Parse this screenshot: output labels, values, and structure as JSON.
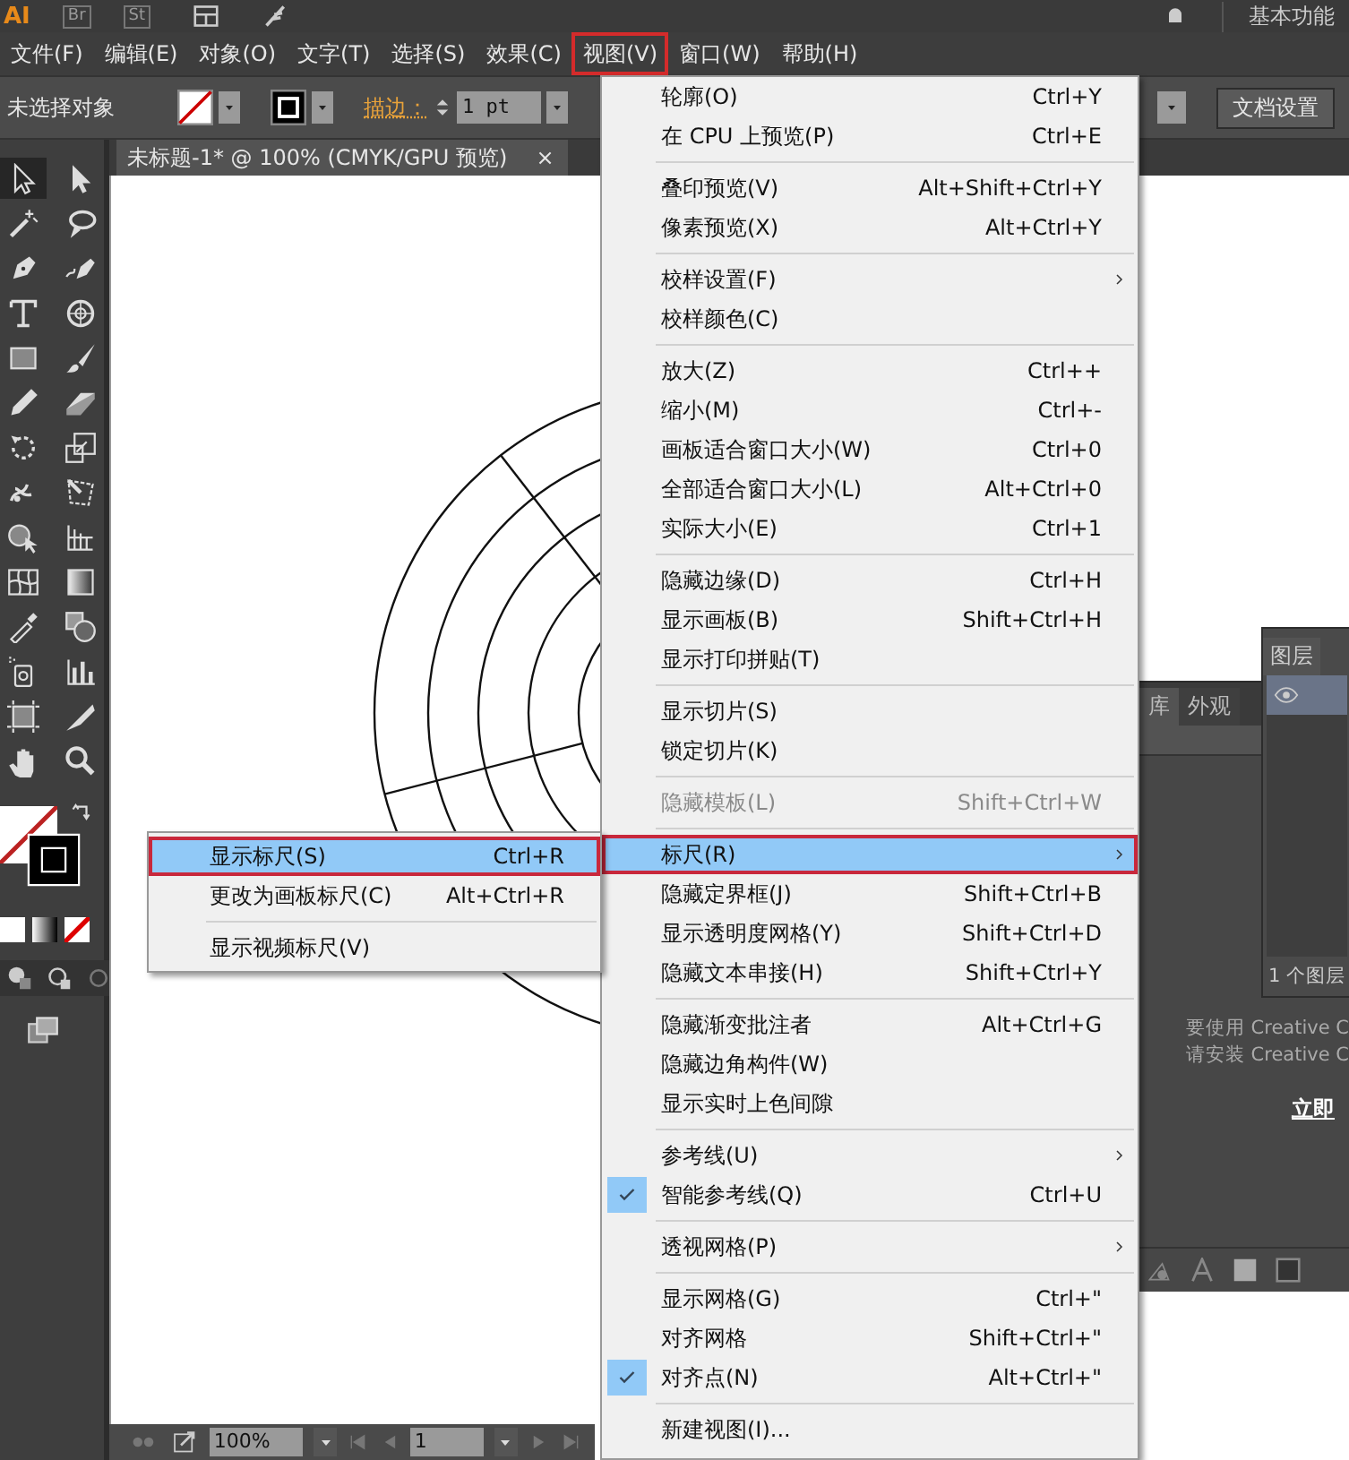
{
  "app_bar": {
    "logo": "AI",
    "apps": [
      "Br",
      "St"
    ],
    "workspace": "基本功能"
  },
  "menu_bar": [
    {
      "label": "文件(F)",
      "selected": false
    },
    {
      "label": "编辑(E)",
      "selected": false
    },
    {
      "label": "对象(O)",
      "selected": false
    },
    {
      "label": "文字(T)",
      "selected": false
    },
    {
      "label": "选择(S)",
      "selected": false
    },
    {
      "label": "效果(C)",
      "selected": false
    },
    {
      "label": "视图(V)",
      "selected": true
    },
    {
      "label": "窗口(W)",
      "selected": false
    },
    {
      "label": "帮助(H)",
      "selected": false
    }
  ],
  "control_bar": {
    "selection_status": "未选择对象",
    "stroke_label": "描边：",
    "stroke_weight": "1 pt",
    "doc_settings_button": "文档设置"
  },
  "document_tab": {
    "title": "未标题-1* @ 100% (CMYK/GPU 预览)",
    "close": "×"
  },
  "tools": [
    {
      "selected": true
    },
    {
      "selected": false
    },
    {
      "selected": false
    },
    {
      "selected": false
    },
    {
      "selected": false
    },
    {
      "selected": false
    },
    {
      "selected": false
    },
    {
      "selected": false
    },
    {
      "selected": false
    },
    {
      "selected": false
    },
    {
      "selected": false
    },
    {
      "selected": false
    },
    {
      "selected": false
    },
    {
      "selected": false
    },
    {
      "selected": false
    },
    {
      "selected": false
    },
    {
      "selected": false
    },
    {
      "selected": false
    },
    {
      "selected": false
    },
    {
      "selected": false
    },
    {
      "selected": false
    },
    {
      "selected": false
    },
    {
      "selected": false
    },
    {
      "selected": false
    },
    {
      "selected": false
    },
    {
      "selected": false
    },
    {
      "selected": false
    },
    {
      "selected": false
    }
  ],
  "status_bar": {
    "zoom": "100%",
    "page": "1"
  },
  "view_menu": [
    {
      "kind": "item",
      "label": "轮廓(O)",
      "shortcut": "Ctrl+Y",
      "checked": false,
      "disabled": false,
      "selected": false,
      "submenu": false
    },
    {
      "kind": "item",
      "label": "在 CPU 上预览(P)",
      "shortcut": "Ctrl+E",
      "checked": false,
      "disabled": false,
      "selected": false,
      "submenu": false
    },
    {
      "kind": "separator"
    },
    {
      "kind": "item",
      "label": "叠印预览(V)",
      "shortcut": "Alt+Shift+Ctrl+Y",
      "checked": false,
      "disabled": false,
      "selected": false,
      "submenu": false
    },
    {
      "kind": "item",
      "label": "像素预览(X)",
      "shortcut": "Alt+Ctrl+Y",
      "checked": false,
      "disabled": false,
      "selected": false,
      "submenu": false
    },
    {
      "kind": "separator"
    },
    {
      "kind": "item",
      "label": "校样设置(F)",
      "checked": false,
      "disabled": false,
      "selected": false,
      "submenu": true
    },
    {
      "kind": "item",
      "label": "校样颜色(C)",
      "checked": false,
      "disabled": false,
      "selected": false,
      "submenu": false
    },
    {
      "kind": "separator"
    },
    {
      "kind": "item",
      "label": "放大(Z)",
      "shortcut": "Ctrl++",
      "checked": false,
      "disabled": false,
      "selected": false,
      "submenu": false
    },
    {
      "kind": "item",
      "label": "缩小(M)",
      "shortcut": "Ctrl+-",
      "checked": false,
      "disabled": false,
      "selected": false,
      "submenu": false
    },
    {
      "kind": "item",
      "label": "画板适合窗口大小(W)",
      "shortcut": "Ctrl+0",
      "checked": false,
      "disabled": false,
      "selected": false,
      "submenu": false
    },
    {
      "kind": "item",
      "label": "全部适合窗口大小(L)",
      "shortcut": "Alt+Ctrl+0",
      "checked": false,
      "disabled": false,
      "selected": false,
      "submenu": false
    },
    {
      "kind": "item",
      "label": "实际大小(E)",
      "shortcut": "Ctrl+1",
      "checked": false,
      "disabled": false,
      "selected": false,
      "submenu": false
    },
    {
      "kind": "separator"
    },
    {
      "kind": "item",
      "label": "隐藏边缘(D)",
      "shortcut": "Ctrl+H",
      "checked": false,
      "disabled": false,
      "selected": false,
      "submenu": false
    },
    {
      "kind": "item",
      "label": "显示画板(B)",
      "shortcut": "Shift+Ctrl+H",
      "checked": false,
      "disabled": false,
      "selected": false,
      "submenu": false
    },
    {
      "kind": "item",
      "label": "显示打印拼贴(T)",
      "checked": false,
      "disabled": false,
      "selected": false,
      "submenu": false
    },
    {
      "kind": "separator"
    },
    {
      "kind": "item",
      "label": "显示切片(S)",
      "checked": false,
      "disabled": false,
      "selected": false,
      "submenu": false
    },
    {
      "kind": "item",
      "label": "锁定切片(K)",
      "checked": false,
      "disabled": false,
      "selected": false,
      "submenu": false
    },
    {
      "kind": "separator"
    },
    {
      "kind": "item",
      "label": "隐藏模板(L)",
      "shortcut": "Shift+Ctrl+W",
      "checked": false,
      "disabled": true,
      "selected": false,
      "submenu": false
    },
    {
      "kind": "separator"
    },
    {
      "kind": "item",
      "label": "标尺(R)",
      "checked": false,
      "disabled": false,
      "selected": true,
      "submenu": true
    },
    {
      "kind": "item",
      "label": "隐藏定界框(J)",
      "shortcut": "Shift+Ctrl+B",
      "checked": false,
      "disabled": false,
      "selected": false,
      "submenu": false
    },
    {
      "kind": "item",
      "label": "显示透明度网格(Y)",
      "shortcut": "Shift+Ctrl+D",
      "checked": false,
      "disabled": false,
      "selected": false,
      "submenu": false
    },
    {
      "kind": "item",
      "label": "隐藏文本串接(H)",
      "shortcut": "Shift+Ctrl+Y",
      "checked": false,
      "disabled": false,
      "selected": false,
      "submenu": false
    },
    {
      "kind": "separator"
    },
    {
      "kind": "item",
      "label": "隐藏渐变批注者",
      "shortcut": "Alt+Ctrl+G",
      "checked": false,
      "disabled": false,
      "selected": false,
      "submenu": false
    },
    {
      "kind": "item",
      "label": "隐藏边角构件(W)",
      "checked": false,
      "disabled": false,
      "selected": false,
      "submenu": false
    },
    {
      "kind": "item",
      "label": "显示实时上色间隙",
      "checked": false,
      "disabled": false,
      "selected": false,
      "submenu": false
    },
    {
      "kind": "separator"
    },
    {
      "kind": "item",
      "label": "参考线(U)",
      "checked": false,
      "disabled": false,
      "selected": false,
      "submenu": true
    },
    {
      "kind": "item",
      "label": "智能参考线(Q)",
      "shortcut": "Ctrl+U",
      "checked": true,
      "disabled": false,
      "selected": false,
      "submenu": false
    },
    {
      "kind": "separator"
    },
    {
      "kind": "item",
      "label": "透视网格(P)",
      "checked": false,
      "disabled": false,
      "selected": false,
      "submenu": true
    },
    {
      "kind": "separator"
    },
    {
      "kind": "item",
      "label": "显示网格(G)",
      "shortcut": "Ctrl+\"",
      "checked": false,
      "disabled": false,
      "selected": false,
      "submenu": false
    },
    {
      "kind": "item",
      "label": "对齐网格",
      "shortcut": "Shift+Ctrl+\"",
      "checked": false,
      "disabled": false,
      "selected": false,
      "submenu": false
    },
    {
      "kind": "item",
      "label": "对齐点(N)",
      "shortcut": "Alt+Ctrl+\"",
      "checked": true,
      "disabled": false,
      "selected": false,
      "submenu": false
    },
    {
      "kind": "separator"
    },
    {
      "kind": "item",
      "label": "新建视图(I)...",
      "checked": false,
      "disabled": false,
      "selected": false,
      "submenu": false
    }
  ],
  "ruler_submenu": [
    {
      "kind": "item",
      "label": "显示标尺(S)",
      "shortcut": "Ctrl+R",
      "selected": true
    },
    {
      "kind": "item",
      "label": "更改为画板标尺(C)",
      "shortcut": "Alt+Ctrl+R",
      "selected": false
    },
    {
      "kind": "separator"
    },
    {
      "kind": "item",
      "label": "显示视频标尺(V)",
      "selected": false
    }
  ],
  "libraries_panel": {
    "tabs": [
      {
        "label": "库",
        "selected": true
      },
      {
        "label": "外观",
        "selected": false
      }
    ],
    "messages": [
      "要使用 Creative C",
      "请安装 Creative C"
    ],
    "link": "立即"
  },
  "layers_panel": {
    "tab": "图层",
    "footer": "1 个图层"
  }
}
